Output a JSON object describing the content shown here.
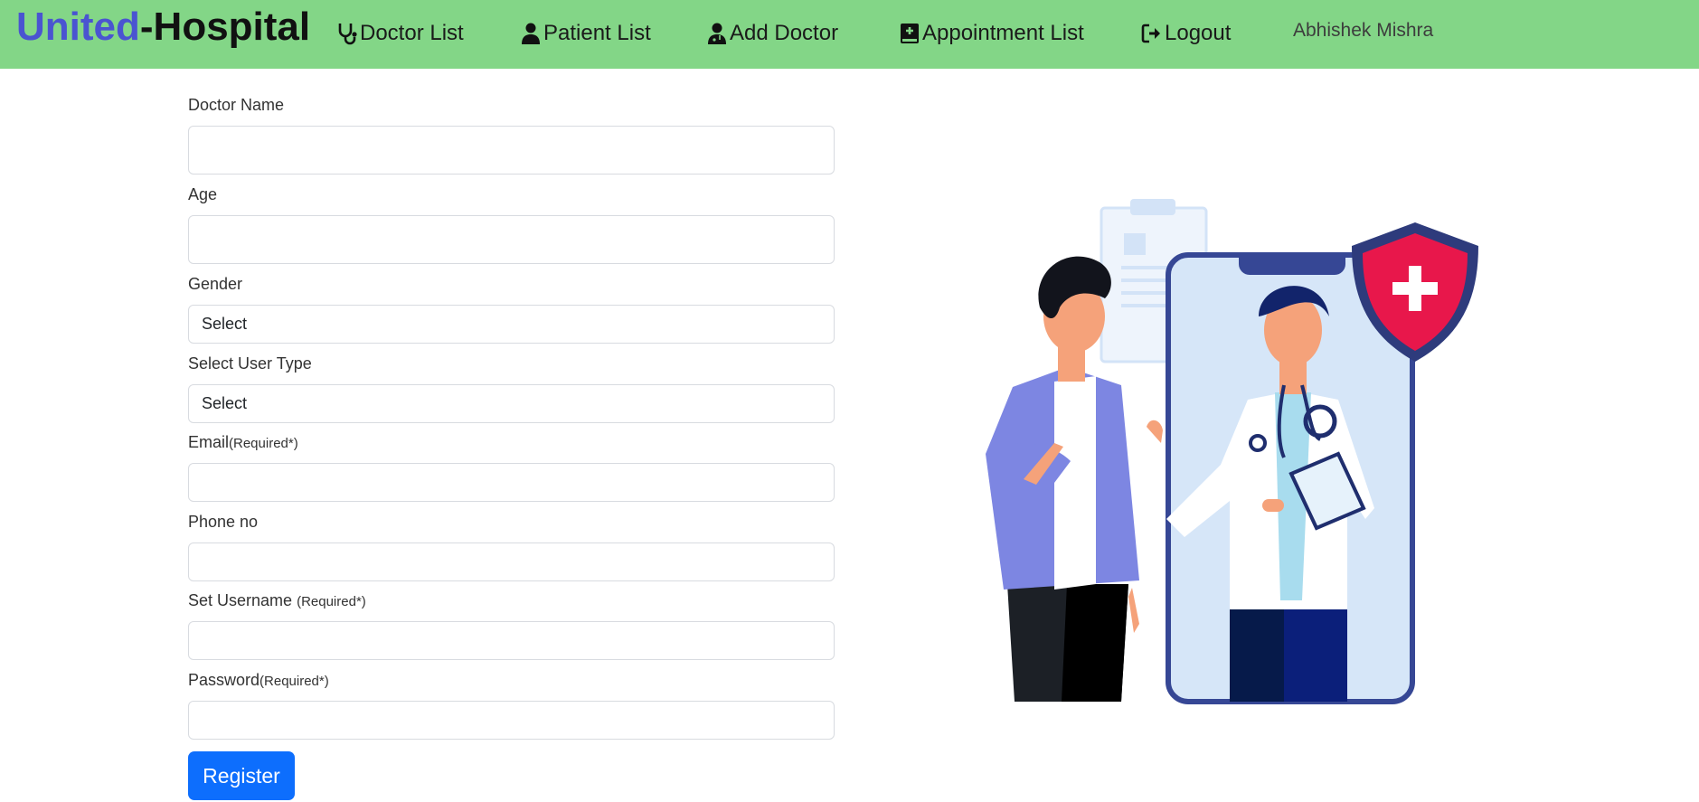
{
  "navbar": {
    "brand_part1": "United",
    "brand_part2": "-Hospital",
    "items": [
      {
        "label": "Doctor List",
        "icon": "stethoscope-icon"
      },
      {
        "label": "Patient List",
        "icon": "user-icon"
      },
      {
        "label": "Add Doctor",
        "icon": "user-doctor-icon"
      },
      {
        "label": "Appointment List",
        "icon": "book-medical-icon"
      },
      {
        "label": "Logout",
        "icon": "sign-out-icon"
      }
    ],
    "user_name": "Abhishek Mishra",
    "background_color": "#83d687",
    "brand_color": "#4a54d1"
  },
  "form": {
    "doctor_name": {
      "label": "Doctor Name",
      "value": ""
    },
    "age": {
      "label": "Age",
      "value": ""
    },
    "gender": {
      "label": "Gender",
      "selected": "Select"
    },
    "user_type": {
      "label": "Select User Type",
      "selected": "Select"
    },
    "email": {
      "label": "Email",
      "note": "(Required*)",
      "value": ""
    },
    "phone": {
      "label": "Phone no",
      "value": ""
    },
    "username": {
      "label": "Set Username",
      "note": "(Required*)",
      "value": ""
    },
    "password": {
      "label": "Password",
      "note": "(Required*)",
      "value": ""
    },
    "register_label": "Register",
    "button_color": "#0d6efd"
  }
}
